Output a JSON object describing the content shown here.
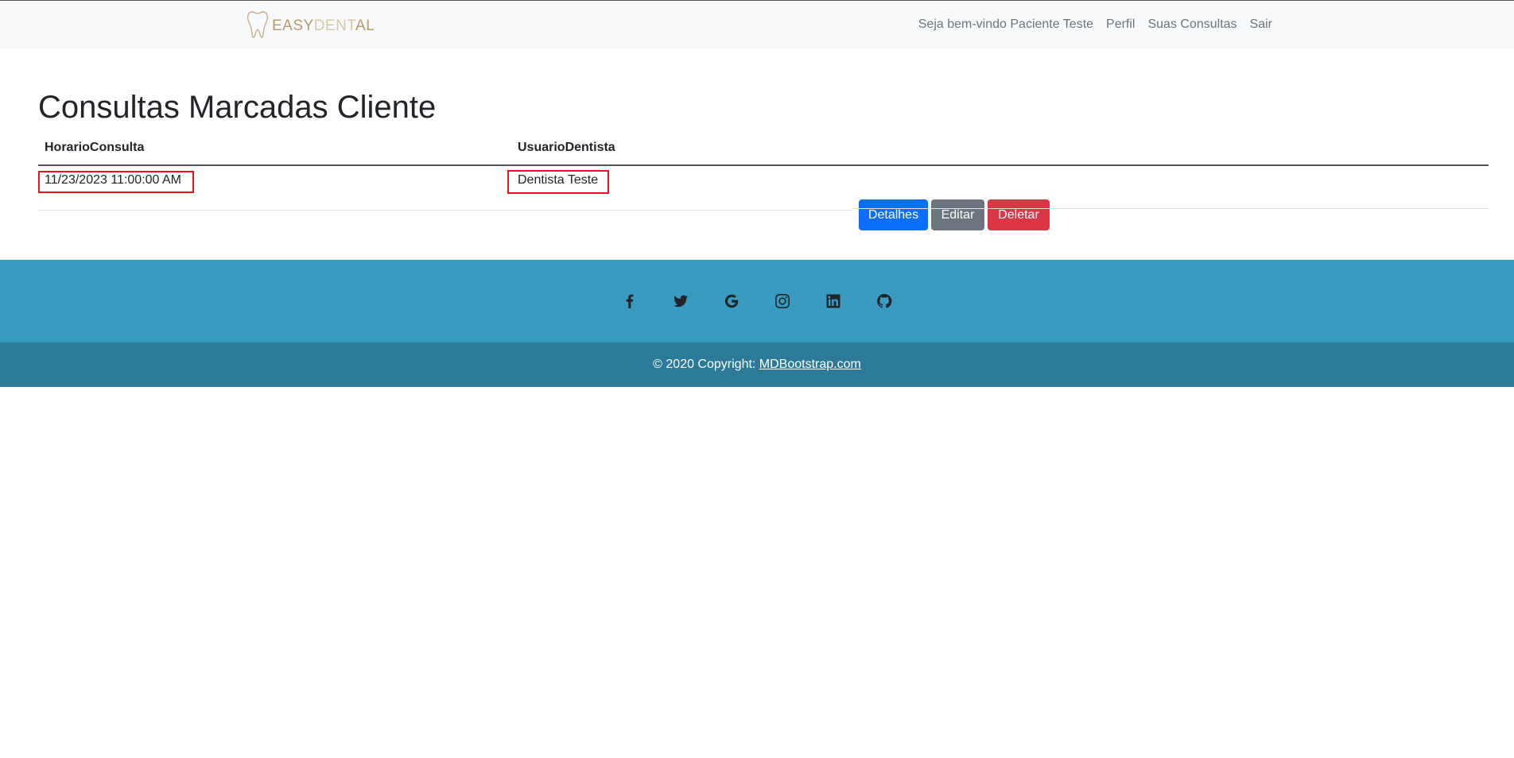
{
  "navbar": {
    "brand": {
      "part1": "EASY",
      "part2": "DENT",
      "part3": "AL",
      "icon": "tooth-icon"
    },
    "welcome": "Seja bem-vindo Paciente Teste",
    "links": [
      "Perfil",
      "Suas Consultas",
      "Sair"
    ]
  },
  "main": {
    "title": "Consultas Marcadas Cliente",
    "columns": [
      "HorarioConsulta",
      "UsuarioDentista"
    ],
    "rows": [
      {
        "horario": "11/23/2023 11:00:00 AM",
        "dentista": "Dentista Teste",
        "actions": [
          "Detalhes",
          "Editar",
          "Deletar"
        ]
      }
    ]
  },
  "footer": {
    "social_icons": [
      "facebook-icon",
      "twitter-icon",
      "google-icon",
      "instagram-icon",
      "linkedin-icon",
      "github-icon"
    ],
    "copyright_prefix": "© 2020 Copyright: ",
    "copyright_link": "MDBootstrap.com"
  },
  "colors": {
    "primary": "#0d6efd",
    "secondary": "#6c757d",
    "danger": "#dc3545",
    "footer_top": "#3a9bc1",
    "footer_bottom": "#2b7a99",
    "highlight": "#e8131f"
  }
}
